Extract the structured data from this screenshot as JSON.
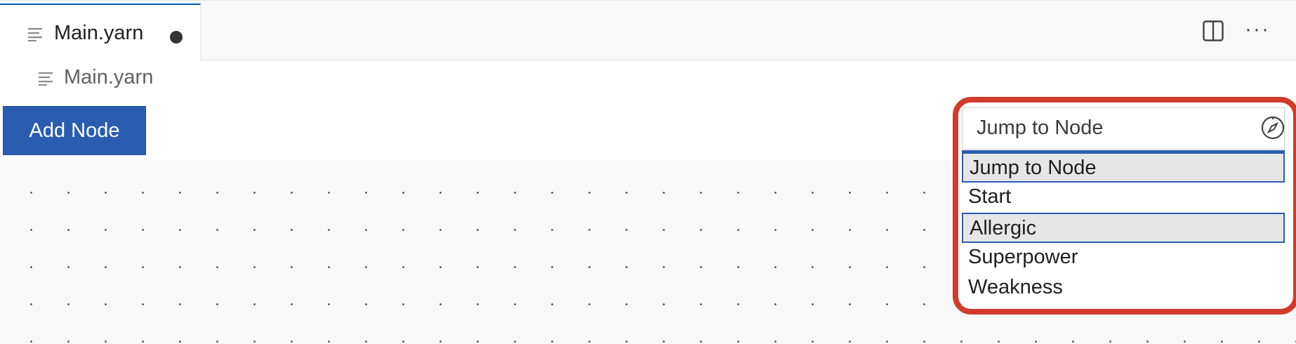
{
  "tabbar": {
    "active_tab_label": "Main.yarn",
    "split_icon": "split-editor-icon",
    "more_icon": "more-actions-icon",
    "more_glyph": "···"
  },
  "breadcrumb": {
    "file_label": "Main.yarn"
  },
  "toolbar": {
    "add_node_label": "Add Node"
  },
  "jump_to_node": {
    "current_value": "Jump to Node",
    "icon": "compass-icon",
    "options": [
      {
        "label": "Jump to Node",
        "selected": true
      },
      {
        "label": "Start",
        "selected": false
      },
      {
        "label": "Allergic",
        "selected": true
      },
      {
        "label": "Superpower",
        "selected": false
      },
      {
        "label": "Weakness",
        "selected": false
      }
    ]
  },
  "colors": {
    "accent": "#2a5db0",
    "highlight": "#d13a2a"
  }
}
